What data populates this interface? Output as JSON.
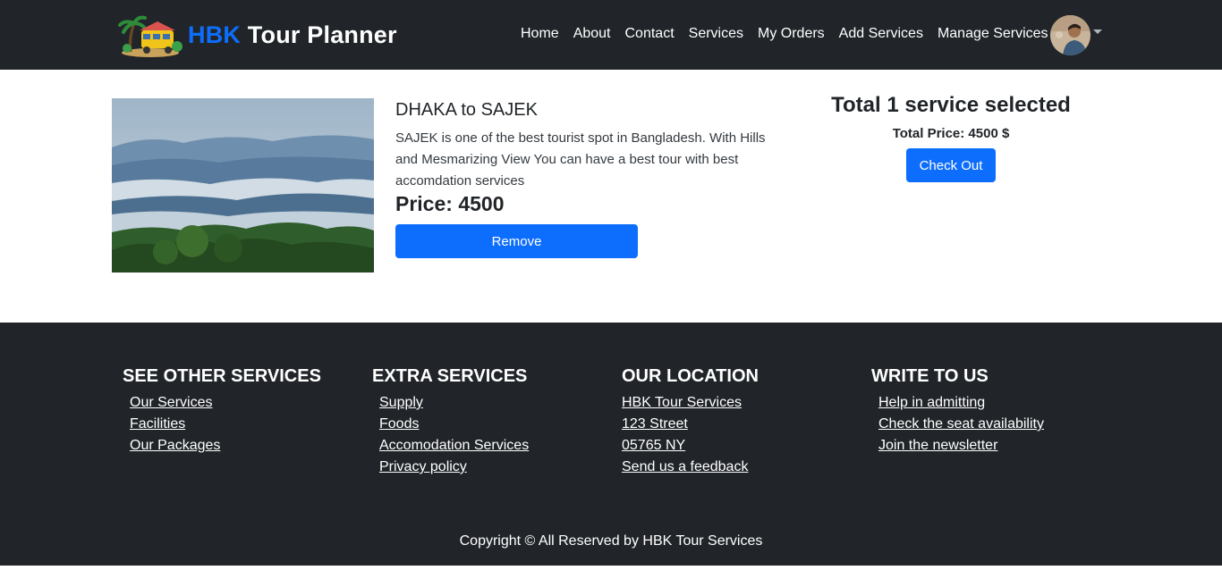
{
  "navbar": {
    "brand_accent": "HBK",
    "brand_rest": " Tour Planner",
    "links": [
      "Home",
      "About",
      "Contact",
      "Services",
      "My Orders",
      "Add Services",
      "Manage Services"
    ]
  },
  "cart": {
    "item": {
      "title": "DHAKA to SAJEK",
      "description": "SAJEK is one of the best tourist spot in Bangladesh. With Hills and Mesmarizing View You can have a best tour with best accomdation services",
      "price": "Price: 4500",
      "remove_label": "Remove"
    },
    "summary": {
      "title": "Total 1 service selected",
      "total_price": "Total Price: 4500 $",
      "checkout_label": "Check Out"
    }
  },
  "footer": {
    "columns": [
      {
        "heading": "SEE OTHER SERVICES",
        "links": [
          "Our Services",
          "Facilities",
          "Our Packages"
        ]
      },
      {
        "heading": "EXTRA SERVICES",
        "links": [
          "Supply",
          "Foods",
          "Accomodation Services",
          "Privacy policy"
        ]
      },
      {
        "heading": "OUR LOCATION",
        "links": [
          "HBK Tour Services",
          "123 Street",
          "05765 NY",
          "Send us a feedback"
        ]
      },
      {
        "heading": "WRITE TO US",
        "links": [
          "Help in admitting",
          "Check the seat availability",
          "Join the newsletter"
        ]
      }
    ],
    "copyright": "Copyright © All Reserved by HBK Tour Services"
  },
  "colors": {
    "dark": "#212529",
    "primary": "#0d6efd",
    "white": "#ffffff"
  }
}
